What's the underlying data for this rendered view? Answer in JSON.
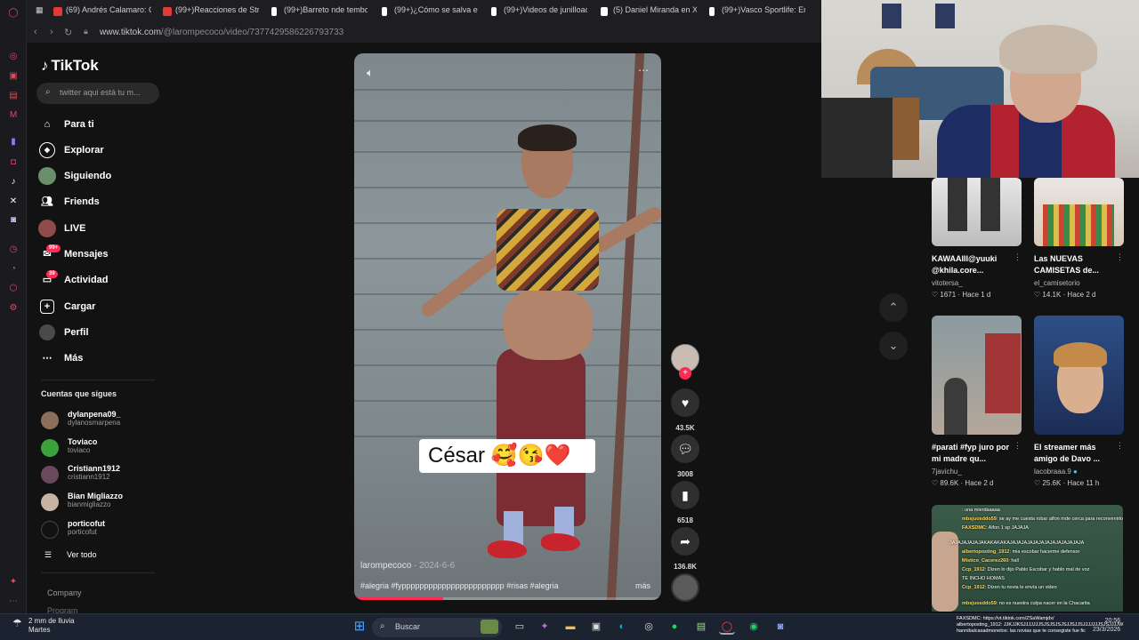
{
  "browser": {
    "tabs": [
      {
        "label": "(69) Andrés Calamaro: C",
        "color": "#e53935"
      },
      {
        "label": "(99+)Reacciones de Stre",
        "color": "#e53935"
      },
      {
        "label": "(99+)Barreto nde tembo",
        "color": "#ffffff"
      },
      {
        "label": "(99+)¿Cómo se salva en",
        "color": "#ffffff"
      },
      {
        "label": "(99+)Videos de junilloac",
        "color": "#ffffff"
      },
      {
        "label": "(5) Daniel Miranda en X:",
        "color": "#ffffff"
      },
      {
        "label": "(99+)Vasco Sportlife: Em",
        "color": "#ffffff"
      }
    ],
    "url_host": "www.tiktok.com",
    "url_path": "/@larompecoco/video/7377429586226793733"
  },
  "sidebar": {
    "logo": "TikTok",
    "search_placeholder": "twitter aqui está tu m...",
    "nav": [
      {
        "label": "Para ti",
        "icon": "home-icon"
      },
      {
        "label": "Explorar",
        "icon": "compass-icon"
      },
      {
        "label": "Siguiendo",
        "icon": "following-icon"
      },
      {
        "label": "Friends",
        "icon": "friends-icon"
      },
      {
        "label": "LIVE",
        "icon": "live-icon"
      },
      {
        "label": "Mensajes",
        "icon": "messages-icon",
        "badge": "99+"
      },
      {
        "label": "Actividad",
        "icon": "activity-icon",
        "badge": "39"
      },
      {
        "label": "Cargar",
        "icon": "upload-icon"
      },
      {
        "label": "Perfil",
        "icon": "profile-icon"
      },
      {
        "label": "Más",
        "icon": "more-icon"
      }
    ],
    "following_title": "Cuentas que sigues",
    "accounts": [
      {
        "name": "dylanpena09_",
        "user": "dylanosmarpena"
      },
      {
        "name": "Toviaco",
        "user": "toviaco"
      },
      {
        "name": "Cristiann1912",
        "user": "cristiann1912"
      },
      {
        "name": "Bian Migliazzo",
        "user": "bianmigliazzo"
      },
      {
        "name": "porticofut",
        "user": "porticofut"
      }
    ],
    "see_all": "Ver todo",
    "company": "Company",
    "program": "Program"
  },
  "video": {
    "caption": "César 🥰😘❤️",
    "author": "larompecoco",
    "date": "2024-6-6",
    "tags": "#alegria #fyppppppppppppppppppppppp #risas #alegria",
    "more": "más",
    "progress": 0.29
  },
  "actions": {
    "likes": "43.5K",
    "comments": "3008",
    "saves": "6518",
    "shares": "136.8K"
  },
  "related": [
    {
      "title": "KAWAAIII@yuuki @khila.core...",
      "user": "vitotersa_",
      "likes": "1671",
      "time": "Hace 1 d"
    },
    {
      "title": "Las NUEVAS CAMISETAS de...",
      "user": "el_camisetorio",
      "likes": "14.1K",
      "time": "Hace 2 d"
    },
    {
      "title": "#parati #fyp juro por mi madre qu...",
      "user": "7javichu_",
      "likes": "89.6K",
      "time": "Hace 2 d"
    },
    {
      "title": "El streamer más amigo de Davo ...",
      "user": "lacobraaa.9",
      "likes": "25.6K",
      "time": "Hace 11 h"
    }
  ],
  "chat_lines": [
    {
      "user": "",
      "msg": "una mierdaaaaa"
    },
    {
      "user": "mbsjuosddo59",
      "msg": "se ay me cuesta robar alfon mde cerca para reconvenirlo"
    },
    {
      "user": "FAXSDMC",
      "msg": "Alfon 1 sp JAJAJA"
    },
    {
      "user": "",
      "msg": "JAJAJAJAJAJAKAKAKAKAJAJAJAJAJAJAJAJAJAJAJAJAJA"
    },
    {
      "user": "albertoposting_1912",
      "msg": "mia escobar hacerme defensor"
    },
    {
      "user": "Mistico_Cacerez260",
      "msg": "hall"
    },
    {
      "user": "Ccp_1912",
      "msg": "Dizen lo dijo Pablo Escobar y hablo mal de voz"
    },
    {
      "user": "",
      "msg": "TE INCHO HOMAS"
    },
    {
      "user": "Ccp_1912",
      "msg": "Dizen tu novia le envía un video"
    },
    {
      "user": "mbsjuosddo59",
      "msg": "no es nuestra culpa nacer en la Chacarita"
    }
  ],
  "taskbar": {
    "weather_line1": "2 mm de lluvia",
    "weather_line2": "Martes",
    "search": "Buscar",
    "time": "20:56",
    "date": "23/3/2026",
    "chat_bottom": [
      "FAXSDMC: https://vt.tiktok.com/ZSaWamjdx/",
      "albertoposting_1912: JJKJJKSJJJJJJJSJSJSJSJSJJSJJSJJJJJJJSJSJJJJW",
      "hannibalcasadmonetos: las novias que te consegiste fue fic"
    ]
  }
}
